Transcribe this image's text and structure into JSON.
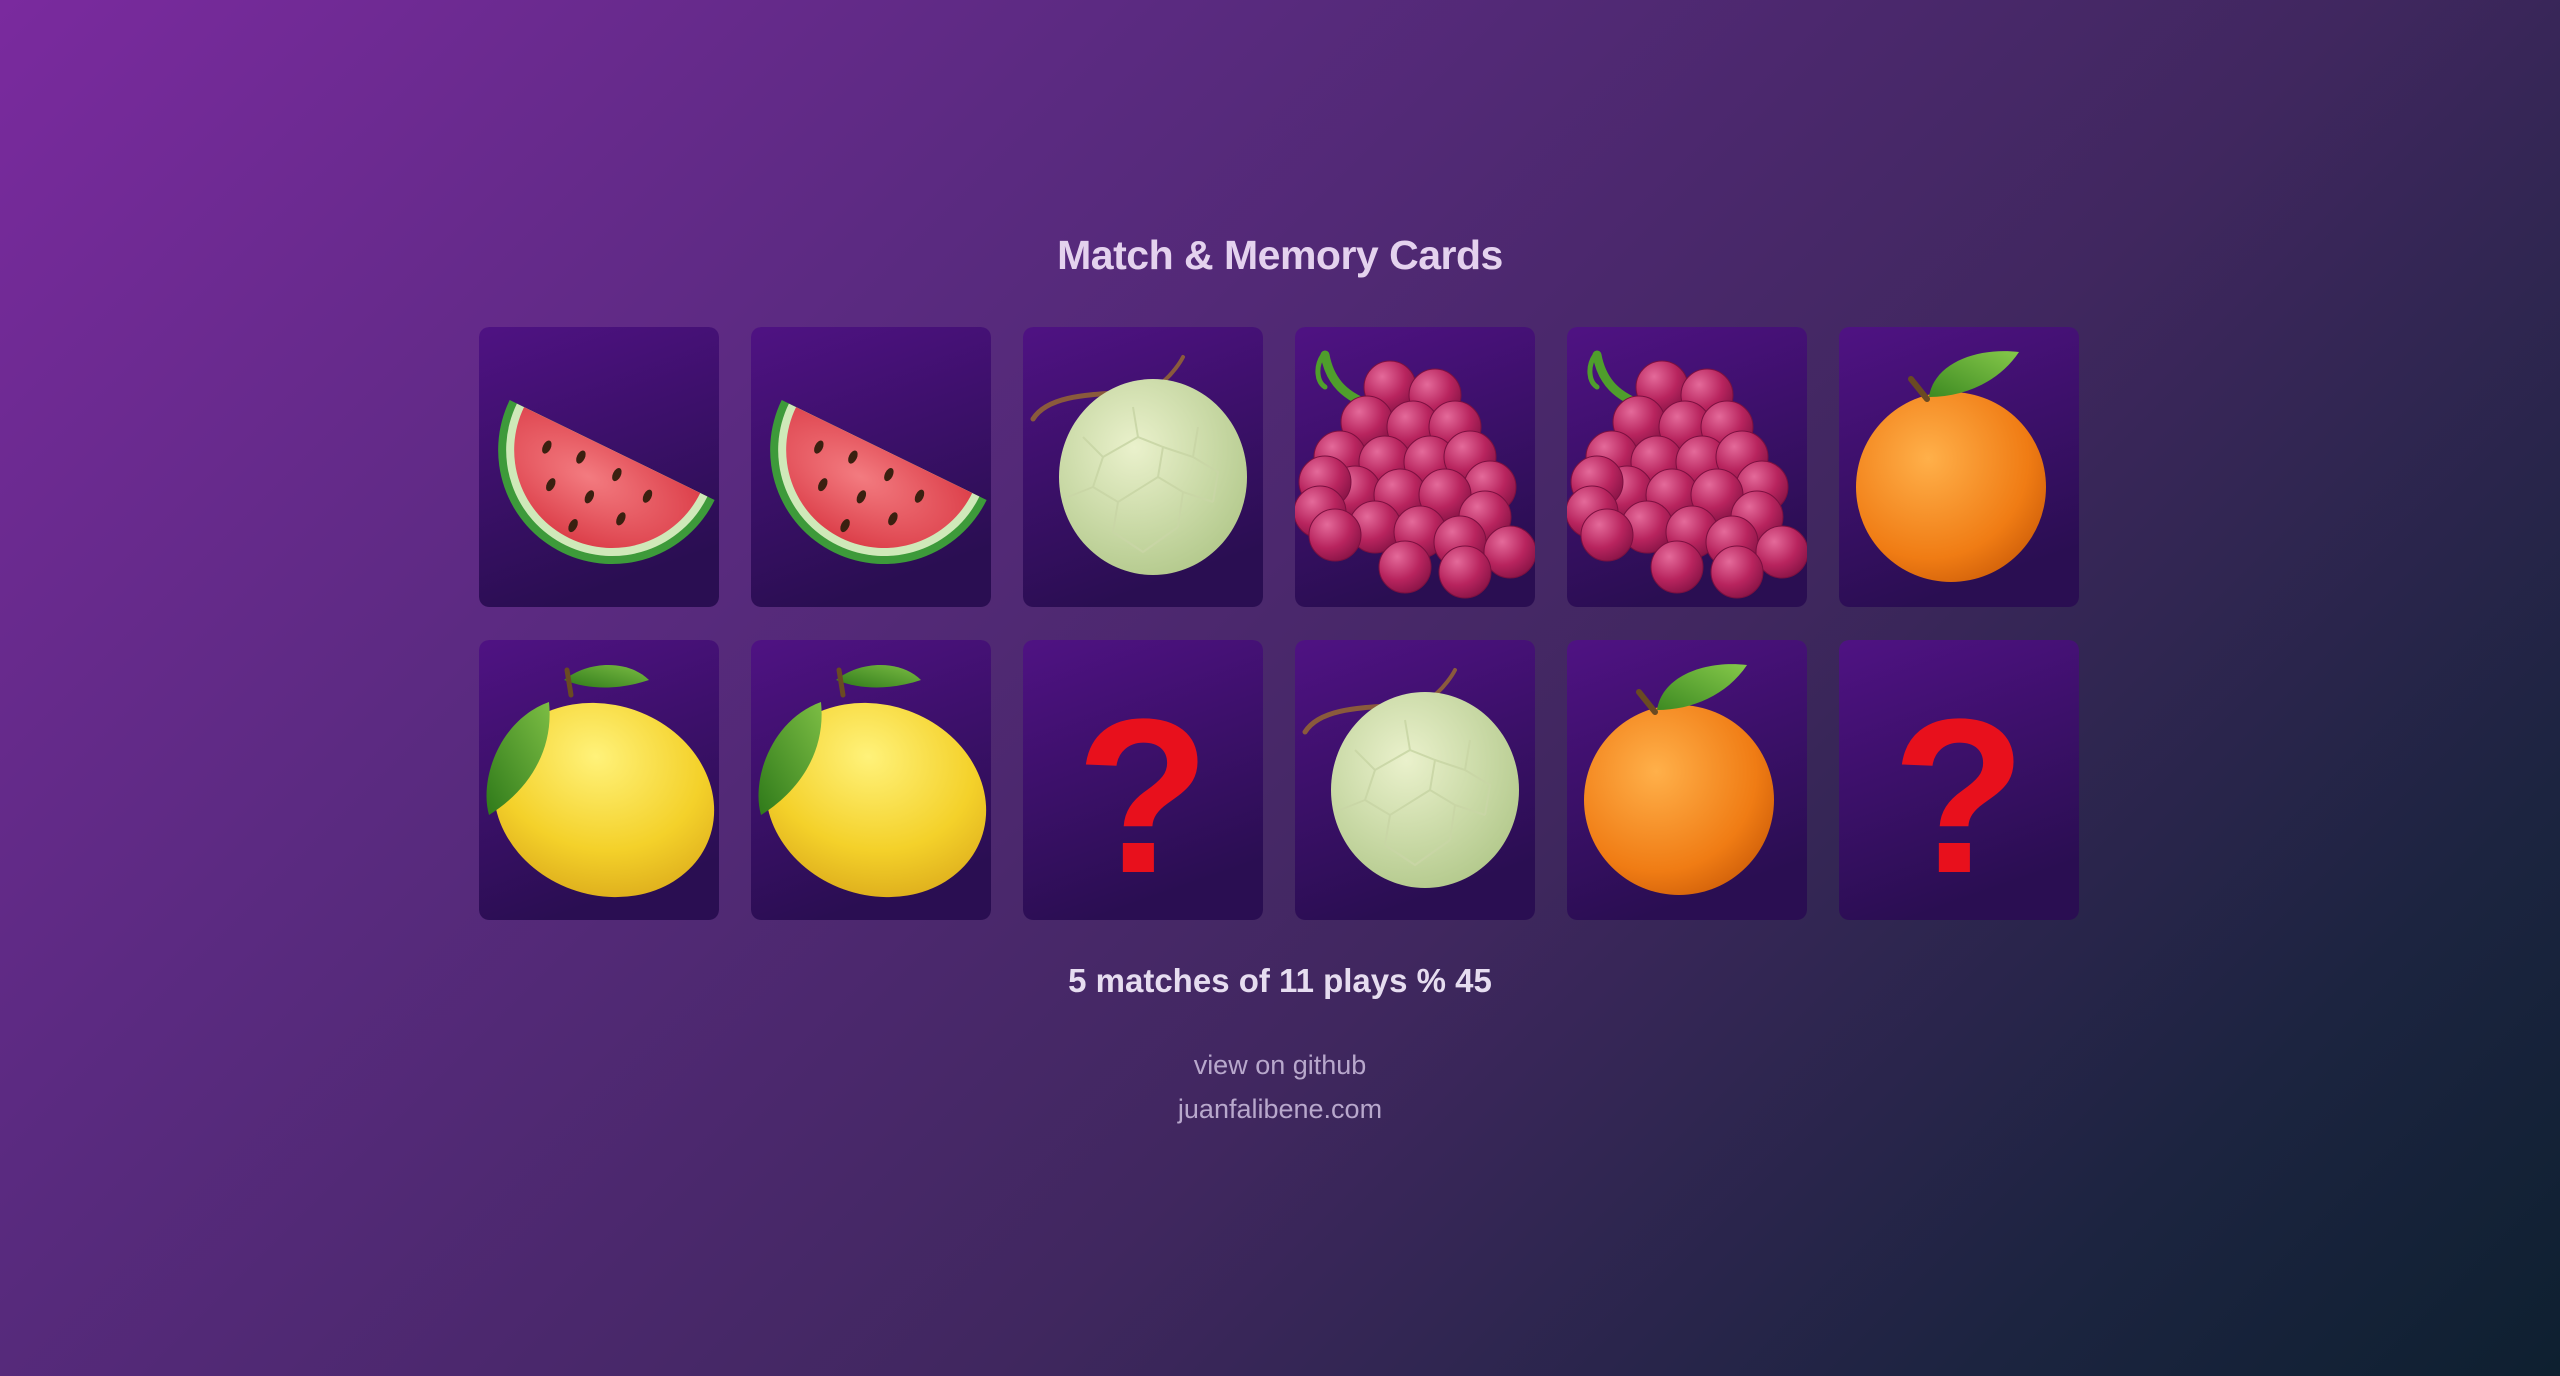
{
  "title": "Match & Memory Cards",
  "cards": [
    {
      "fruit": "watermelon",
      "state": "face-up"
    },
    {
      "fruit": "watermelon",
      "state": "face-up"
    },
    {
      "fruit": "melon",
      "state": "face-up"
    },
    {
      "fruit": "grapes",
      "state": "face-up"
    },
    {
      "fruit": "grapes",
      "state": "face-up"
    },
    {
      "fruit": "orange",
      "state": "face-up"
    },
    {
      "fruit": "lemon",
      "state": "face-up"
    },
    {
      "fruit": "lemon",
      "state": "face-up"
    },
    {
      "fruit": "question",
      "state": "face-down"
    },
    {
      "fruit": "melon",
      "state": "face-up"
    },
    {
      "fruit": "orange",
      "state": "face-up"
    },
    {
      "fruit": "question",
      "state": "face-down"
    }
  ],
  "stats": {
    "text": "5 matches of 11 plays % 45",
    "matches": 5,
    "plays": 11,
    "percent": 45
  },
  "links": {
    "github": "view on github",
    "site": "juanfalibene.com"
  },
  "colors": {
    "card_top": "#4f1283",
    "card_bottom": "#2a0e52",
    "question_mark": "#e8101c",
    "title": "#e4d2ee"
  }
}
